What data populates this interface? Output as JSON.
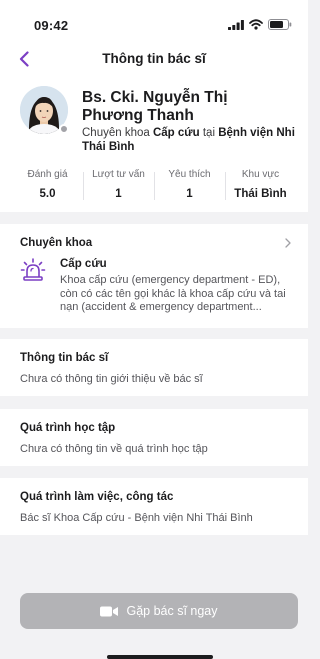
{
  "status_bar": {
    "time": "09:42"
  },
  "nav": {
    "title": "Thông tin bác sĩ"
  },
  "doctor": {
    "name": "Bs. Cki. Nguyễn Thị Phương Thanh",
    "specialty_prefix": "Chuyên khoa",
    "specialty": "Cấp cứu",
    "connector": "tại",
    "hospital": "Bệnh viện Nhi Thái Bình"
  },
  "stats": [
    {
      "label": "Đánh giá",
      "value": "5.0"
    },
    {
      "label": "Lượt tư vấn",
      "value": "1"
    },
    {
      "label": "Yêu thích",
      "value": "1"
    },
    {
      "label": "Khu vực",
      "value": "Thái Bình"
    }
  ],
  "specialty_section": {
    "title": "Chuyên khoa",
    "item_name": "Cấp cứu",
    "item_description": "Khoa cấp cứu (emergency department - ED), còn có các tên gọi khác là khoa cấp cứu và tai nạn (accident & emergency department..."
  },
  "doctor_info": {
    "title": "Thông tin bác sĩ",
    "text": "Chưa có thông tin giới thiệu về bác sĩ"
  },
  "education": {
    "title": "Quá trình học tập",
    "text": "Chưa có thông tin về quá trình học tập"
  },
  "work": {
    "title": "Quá trình làm việc, công tác",
    "text": "Bác sĩ Khoa Cấp cứu - Bệnh viện Nhi Thái Bình"
  },
  "cta": {
    "label": "Gặp bác sĩ ngay"
  },
  "colors": {
    "accent": "#7b3fc4",
    "button_disabled": "#b3b3b6",
    "background": "#f2f2f4"
  },
  "icons": [
    "back-icon",
    "signal-icon",
    "wifi-icon",
    "battery-icon",
    "chevron-right-icon",
    "siren-icon",
    "video-camera-icon"
  ]
}
